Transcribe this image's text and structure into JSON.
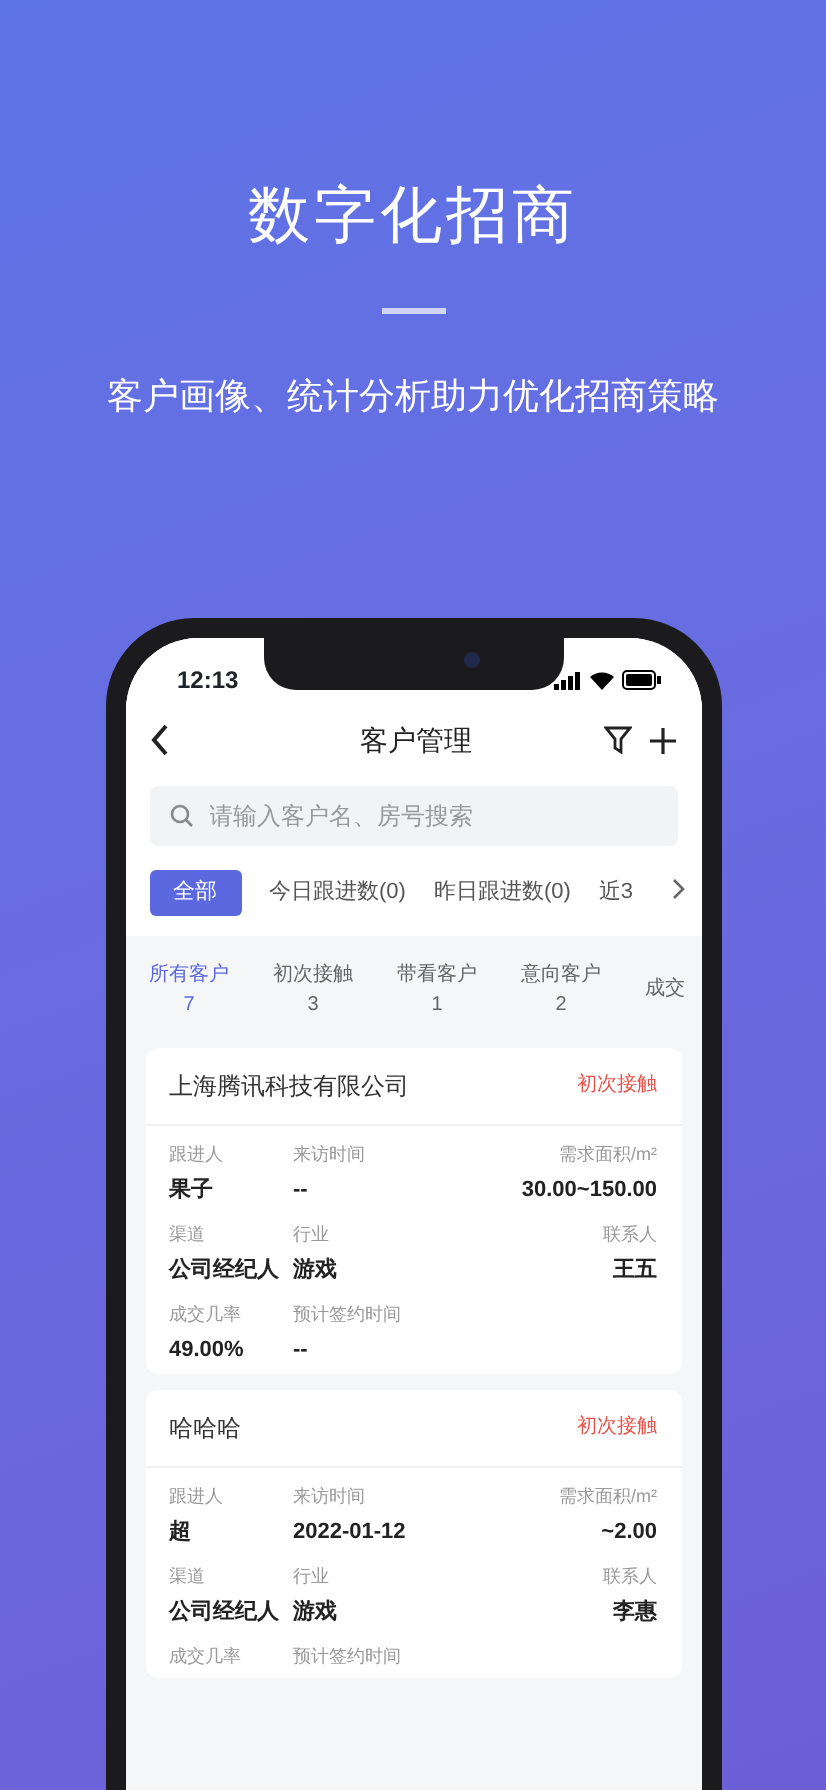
{
  "headline": "数字化招商",
  "subtitle": "客户画像、统计分析助力优化招商策略",
  "phone": {
    "time": "12:13",
    "title": "客户管理",
    "search": {
      "placeholder": "请输入客户名、房号搜索"
    },
    "filters": [
      {
        "label": "全部",
        "selected": true
      },
      {
        "label": "今日跟进数(0)",
        "selected": false
      },
      {
        "label": "昨日跟进数(0)",
        "selected": false
      },
      {
        "label": "近3",
        "selected": false
      }
    ],
    "stages": [
      {
        "label": "所有客户",
        "count": "7",
        "selected": true
      },
      {
        "label": "初次接触",
        "count": "3",
        "selected": false
      },
      {
        "label": "带看客户",
        "count": "1",
        "selected": false
      },
      {
        "label": "意向客户",
        "count": "2",
        "selected": false
      },
      {
        "label": "成交",
        "selected": false
      }
    ],
    "customers": [
      {
        "name": "上海腾讯科技有限公司",
        "status": "初次接触",
        "fields": [
          {
            "label": "跟进人",
            "value": "果子"
          },
          {
            "label": "来访时间",
            "value": "--"
          },
          {
            "label": "需求面积/m²",
            "value": "30.00~150.00"
          },
          {
            "label": "渠道",
            "value": "公司经纪人"
          },
          {
            "label": "行业",
            "value": "游戏"
          },
          {
            "label": "联系人",
            "value": "王五"
          },
          {
            "label": "成交几率",
            "value": "49.00%"
          },
          {
            "label": "预计签约时间",
            "value": "--"
          }
        ]
      },
      {
        "name": "哈哈哈",
        "status": "初次接触",
        "fields": [
          {
            "label": "跟进人",
            "value": "超"
          },
          {
            "label": "来访时间",
            "value": "2022-01-12"
          },
          {
            "label": "需求面积/m²",
            "value": "~2.00"
          },
          {
            "label": "渠道",
            "value": "公司经纪人"
          },
          {
            "label": "行业",
            "value": "游戏"
          },
          {
            "label": "联系人",
            "value": "李惠"
          },
          {
            "label": "成交几率"
          },
          {
            "label": "预计签约时间"
          }
        ]
      }
    ]
  }
}
